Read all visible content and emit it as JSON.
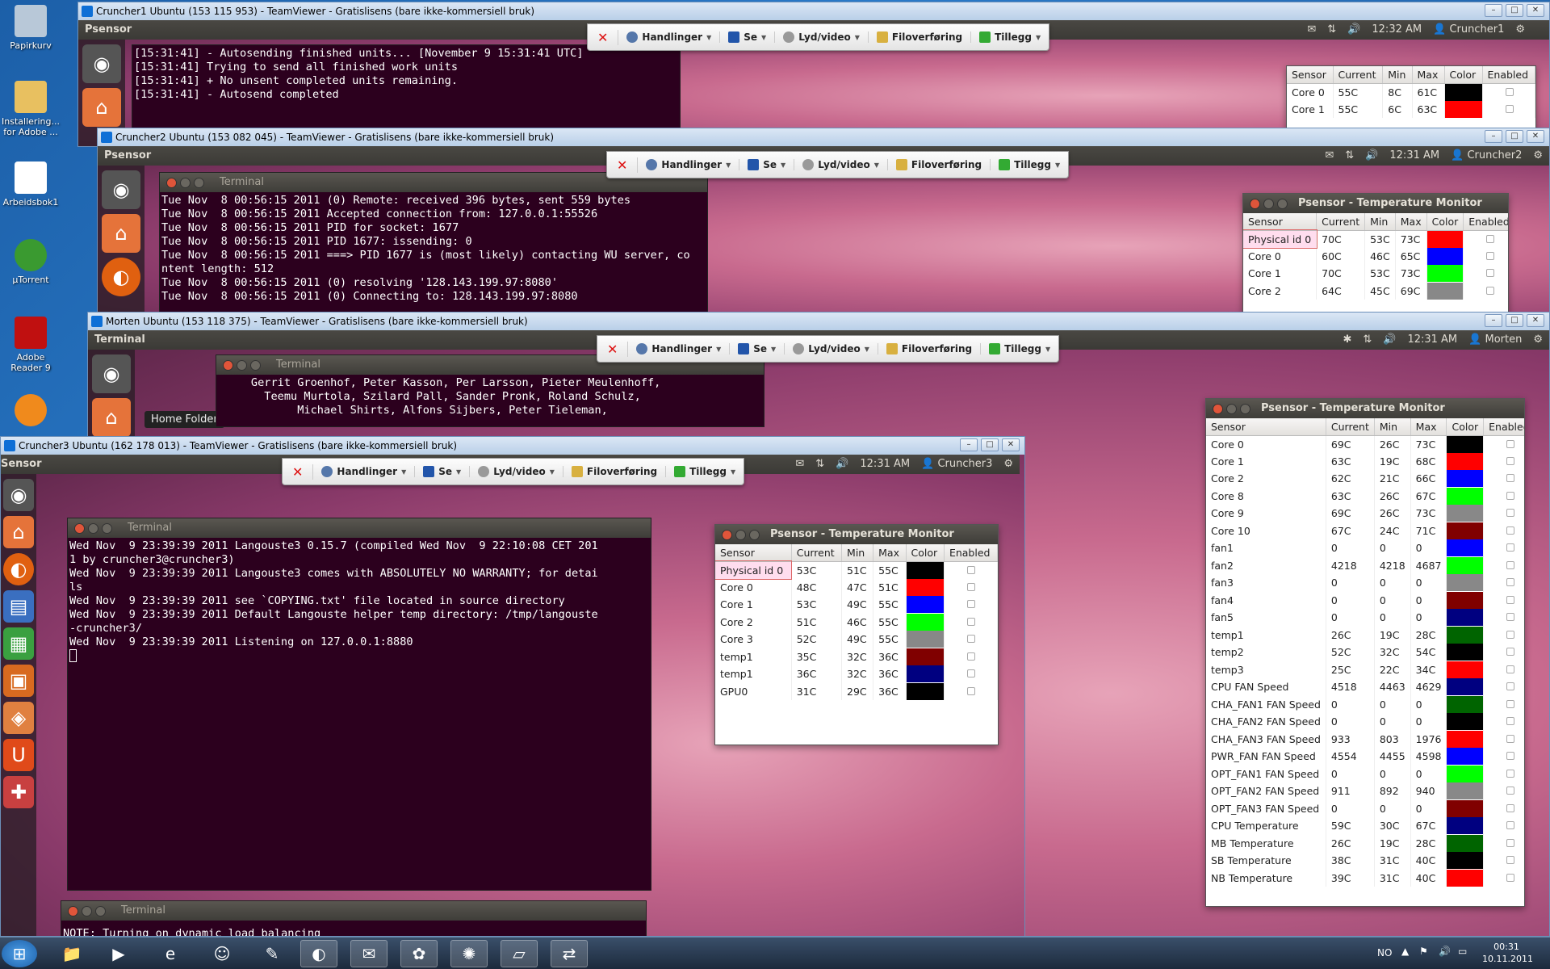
{
  "desktop": {
    "icons": [
      "Papirkurv",
      "Installering... for Adobe ...",
      "Arbeidsbok1",
      "µTorrent",
      "Adobe Reader 9"
    ]
  },
  "windows": [
    {
      "title": "Cruncher1 Ubuntu (153 115 953) - TeamViewer - Gratislisens (bare ikke-kommersiell bruk)",
      "app": "Psensor",
      "time": "12:32 AM",
      "user": "Cruncher1"
    },
    {
      "title": "Cruncher2 Ubuntu (153 082 045) - TeamViewer - Gratislisens (bare ikke-kommersiell bruk)",
      "app": "Psensor",
      "time": "12:31 AM",
      "user": "Cruncher2"
    },
    {
      "title": "Morten Ubuntu (153 118 375) - TeamViewer - Gratislisens (bare ikke-kommersiell bruk)",
      "app": "Terminal",
      "time": "12:31 AM",
      "user": "Morten"
    },
    {
      "title": "Cruncher3 Ubuntu (162 178 013) - TeamViewer - Gratislisens (bare ikke-kommersiell bruk)",
      "app": "Sensor",
      "time": "12:31 AM",
      "user": "Cruncher3"
    }
  ],
  "toolbar": {
    "actions": "Handlinger",
    "view": "Se",
    "audio": "Lyd/video",
    "files": "Filoverføring",
    "extras": "Tillegg"
  },
  "terminals": {
    "title": "Terminal",
    "c1": [
      "[15:31:41] - Autosending finished units... [November 9 15:31:41 UTC]",
      "[15:31:41] Trying to send all finished work units",
      "[15:31:41] + No unsent completed units remaining.",
      "[15:31:41] - Autosend completed"
    ],
    "c2": [
      "Tue Nov  8 00:56:15 2011 (0) Remote: received 396 bytes, sent 559 bytes",
      "Tue Nov  8 00:56:15 2011 Accepted connection from: 127.0.0.1:55526",
      "Tue Nov  8 00:56:15 2011 PID for socket: 1677",
      "Tue Nov  8 00:56:15 2011 PID 1677: issending: 0",
      "Tue Nov  8 00:56:15 2011 ===> PID 1677 is (most likely) contacting WU server, co",
      "ntent length: 512",
      "Tue Nov  8 00:56:15 2011 (0) resolving '128.143.199.97:8080'",
      "Tue Nov  8 00:56:15 2011 (0) Connecting to: 128.143.199.97:8080"
    ],
    "morten": [
      "     Gerrit Groenhof, Peter Kasson, Per Larsson, Pieter Meulenhoff,",
      "       Teemu Murtola, Szilard Pall, Sander Pronk, Roland Schulz,",
      "            Michael Shirts, Alfons Sijbers, Peter Tieleman,"
    ],
    "c3": [
      "Wed Nov  9 23:39:39 2011 Langouste3 0.15.7 (compiled Wed Nov  9 22:10:08 CET 201",
      "1 by cruncher3@cruncher3)",
      "Wed Nov  9 23:39:39 2011 Langouste3 comes with ABSOLUTELY NO WARRANTY; for detai",
      "ls",
      "Wed Nov  9 23:39:39 2011 see `COPYING.txt' file located in source directory",
      "Wed Nov  9 23:39:39 2011 Default Langouste helper temp directory: /tmp/langouste",
      "-cruncher3/",
      "Wed Nov  9 23:39:39 2011 Listening on 127.0.0.1:8880"
    ],
    "c3b": "NOTE: Turning on dynamic load balancing"
  },
  "tooltip": "Home Folder",
  "psensor": {
    "title": "Psensor - Temperature Monitor",
    "headers": [
      "Sensor",
      "Current",
      "Min",
      "Max",
      "Color",
      "Enabled"
    ],
    "c1": [
      [
        "Core 0",
        "55C",
        "8C",
        "61C",
        "#000000"
      ],
      [
        "Core 1",
        "55C",
        "6C",
        "63C",
        "#ff0000"
      ]
    ],
    "c2": [
      [
        "Physical id 0",
        "70C",
        "53C",
        "73C",
        "#ff0000"
      ],
      [
        "Core 0",
        "60C",
        "46C",
        "65C",
        "#0000ff"
      ],
      [
        "Core 1",
        "70C",
        "53C",
        "73C",
        "#00ff00"
      ],
      [
        "Core 2",
        "64C",
        "45C",
        "69C",
        "#888888"
      ]
    ],
    "c3": [
      [
        "Physical id 0",
        "53C",
        "51C",
        "55C",
        "#000000"
      ],
      [
        "Core 0",
        "48C",
        "47C",
        "51C",
        "#ff0000"
      ],
      [
        "Core 1",
        "53C",
        "49C",
        "55C",
        "#0000ff"
      ],
      [
        "Core 2",
        "51C",
        "46C",
        "55C",
        "#00ff00"
      ],
      [
        "Core 3",
        "52C",
        "49C",
        "55C",
        "#888888"
      ],
      [
        "temp1",
        "35C",
        "32C",
        "36C",
        "#800000"
      ],
      [
        "temp1",
        "36C",
        "32C",
        "36C",
        "#000080"
      ],
      [
        "GPU0",
        "31C",
        "29C",
        "36C",
        "#000000"
      ]
    ],
    "morten": [
      [
        "Core 0",
        "69C",
        "26C",
        "73C",
        "#000000"
      ],
      [
        "Core 1",
        "63C",
        "19C",
        "68C",
        "#ff0000"
      ],
      [
        "Core 2",
        "62C",
        "21C",
        "66C",
        "#0000ff"
      ],
      [
        "Core 8",
        "63C",
        "26C",
        "67C",
        "#00ff00"
      ],
      [
        "Core 9",
        "69C",
        "26C",
        "73C",
        "#888888"
      ],
      [
        "Core 10",
        "67C",
        "24C",
        "71C",
        "#800000"
      ],
      [
        "fan1",
        "0",
        "0",
        "0",
        "#0000ff"
      ],
      [
        "fan2",
        "4218",
        "4218",
        "4687",
        "#00ff00"
      ],
      [
        "fan3",
        "0",
        "0",
        "0",
        "#888888"
      ],
      [
        "fan4",
        "0",
        "0",
        "0",
        "#800000"
      ],
      [
        "fan5",
        "0",
        "0",
        "0",
        "#000080"
      ],
      [
        "temp1",
        "26C",
        "19C",
        "28C",
        "#006400"
      ],
      [
        "temp2",
        "52C",
        "32C",
        "54C",
        "#000000"
      ],
      [
        "temp3",
        "25C",
        "22C",
        "34C",
        "#ff0000"
      ],
      [
        "CPU FAN Speed",
        "4518",
        "4463",
        "4629",
        "#000080"
      ],
      [
        "CHA_FAN1 FAN Speed",
        "0",
        "0",
        "0",
        "#006400"
      ],
      [
        "CHA_FAN2 FAN Speed",
        "0",
        "0",
        "0",
        "#000000"
      ],
      [
        "CHA_FAN3 FAN Speed",
        "933",
        "803",
        "1976",
        "#ff0000"
      ],
      [
        "PWR_FAN FAN Speed",
        "4554",
        "4455",
        "4598",
        "#0000ff"
      ],
      [
        "OPT_FAN1 FAN Speed",
        "0",
        "0",
        "0",
        "#00ff00"
      ],
      [
        "OPT_FAN2 FAN Speed",
        "911",
        "892",
        "940",
        "#888888"
      ],
      [
        "OPT_FAN3 FAN Speed",
        "0",
        "0",
        "0",
        "#800000"
      ],
      [
        "CPU Temperature",
        "59C",
        "30C",
        "67C",
        "#000080"
      ],
      [
        "MB Temperature",
        "26C",
        "19C",
        "28C",
        "#006400"
      ],
      [
        "SB Temperature",
        "38C",
        "31C",
        "40C",
        "#000000"
      ],
      [
        "NB Temperature",
        "39C",
        "31C",
        "40C",
        "#ff0000"
      ]
    ]
  },
  "taskbar": {
    "lang": "NO",
    "time": "00:31",
    "date": "10.11.2011"
  }
}
